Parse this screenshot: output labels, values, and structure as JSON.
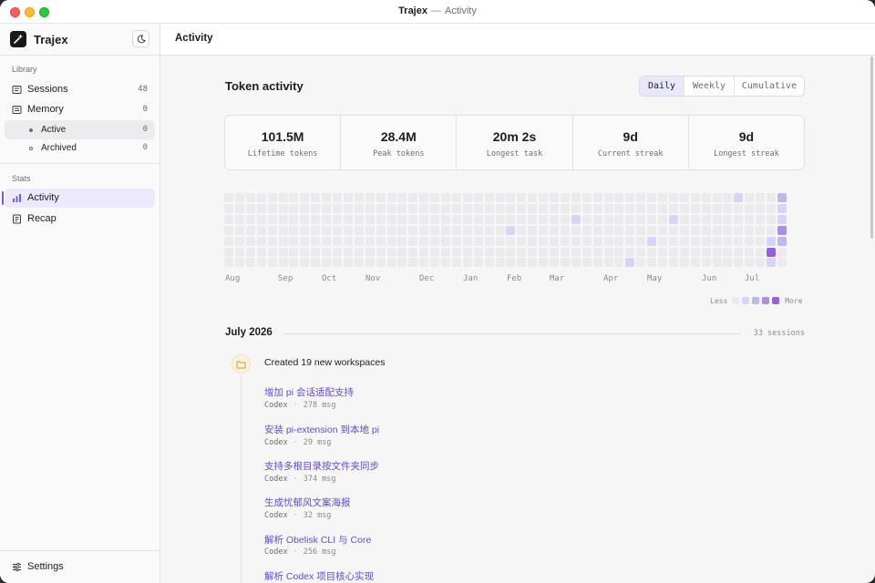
{
  "window": {
    "app": "Trajex",
    "separator": "—",
    "page": "Activity"
  },
  "sidebar": {
    "brand": "Trajex",
    "library_label": "Library",
    "stats_label": "Stats",
    "items": [
      {
        "label": "Sessions",
        "count": "48"
      },
      {
        "label": "Memory",
        "count": "0"
      },
      {
        "label": "Active",
        "count": "0"
      },
      {
        "label": "Archived",
        "count": "0"
      },
      {
        "label": "Activity"
      },
      {
        "label": "Recap"
      }
    ],
    "settings": "Settings"
  },
  "main": {
    "title": "Activity",
    "section_title": "Token activity",
    "tabs": [
      "Daily",
      "Weekly",
      "Cumulative"
    ],
    "selected_tab": "Daily",
    "stats": [
      {
        "value": "101.5M",
        "label": "Lifetime tokens"
      },
      {
        "value": "28.4M",
        "label": "Peak tokens"
      },
      {
        "value": "20m 2s",
        "label": "Longest task"
      },
      {
        "value": "9d",
        "label": "Current streak"
      },
      {
        "value": "9d",
        "label": "Longest streak"
      }
    ],
    "heatmap": {
      "months": [
        "Aug",
        "Sep",
        "Oct",
        "Nov",
        "Dec",
        "Jan",
        "Feb",
        "Mar",
        "Apr",
        "May",
        "Jun",
        "Jul"
      ],
      "legend_less": "Less",
      "legend_more": "More",
      "colors": [
        "#ebebee",
        "#d6d4f7",
        "#bdb8f0",
        "#a98fe6",
        "#9561e0"
      ]
    },
    "group": {
      "title": "July 2026",
      "count": "33 sessions",
      "event": "Created 19 new workspaces",
      "workspaces": [
        {
          "title": "增加 pi 会话适配支持",
          "source": "Codex",
          "msgs": "278 msg"
        },
        {
          "title": "安装 pi-extension 到本地 pi",
          "source": "Codex",
          "msgs": "29 msg"
        },
        {
          "title": "支持多根目录按文件夹同步",
          "source": "Codex",
          "msgs": "374 msg"
        },
        {
          "title": "生成忧郁风文案海报",
          "source": "Codex",
          "msgs": "32 msg"
        },
        {
          "title": "解析 Obelisk CLI 与 Core",
          "source": "Codex",
          "msgs": "256 msg"
        },
        {
          "title": "解析 Codex 项目核心实现"
        }
      ]
    }
  }
}
